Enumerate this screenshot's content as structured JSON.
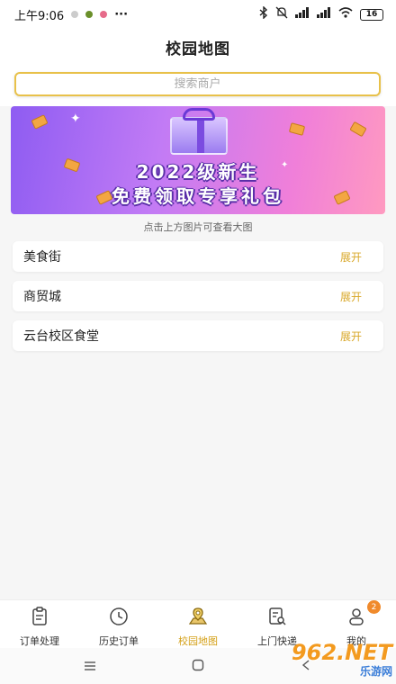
{
  "status_bar": {
    "time": "上午9:06",
    "dots": "···",
    "battery": "16"
  },
  "header": {
    "title": "校园地图"
  },
  "search": {
    "placeholder": "搜索商户"
  },
  "banner": {
    "line1": "2022级新生",
    "line2": "免费领取专享礼包"
  },
  "caption": "点击上方图片可查看大图",
  "sections": [
    {
      "name": "美食街",
      "action": "展开"
    },
    {
      "name": "商贸城",
      "action": "展开"
    },
    {
      "name": "云台校区食堂",
      "action": "展开"
    }
  ],
  "tabs": [
    {
      "label": "订单处理",
      "icon": "clipboard-icon"
    },
    {
      "label": "历史订单",
      "icon": "clock-icon"
    },
    {
      "label": "校园地图",
      "icon": "map-pin-icon",
      "active": true
    },
    {
      "label": "上门快递",
      "icon": "parcel-search-icon"
    },
    {
      "label": "我的",
      "icon": "profile-icon",
      "badge": "2"
    }
  ],
  "watermark": {
    "main": "962.NET",
    "sub": "乐游网"
  },
  "colors": {
    "accent": "#d4a017",
    "search_border": "#e8c14a",
    "badge": "#f08a2c"
  }
}
